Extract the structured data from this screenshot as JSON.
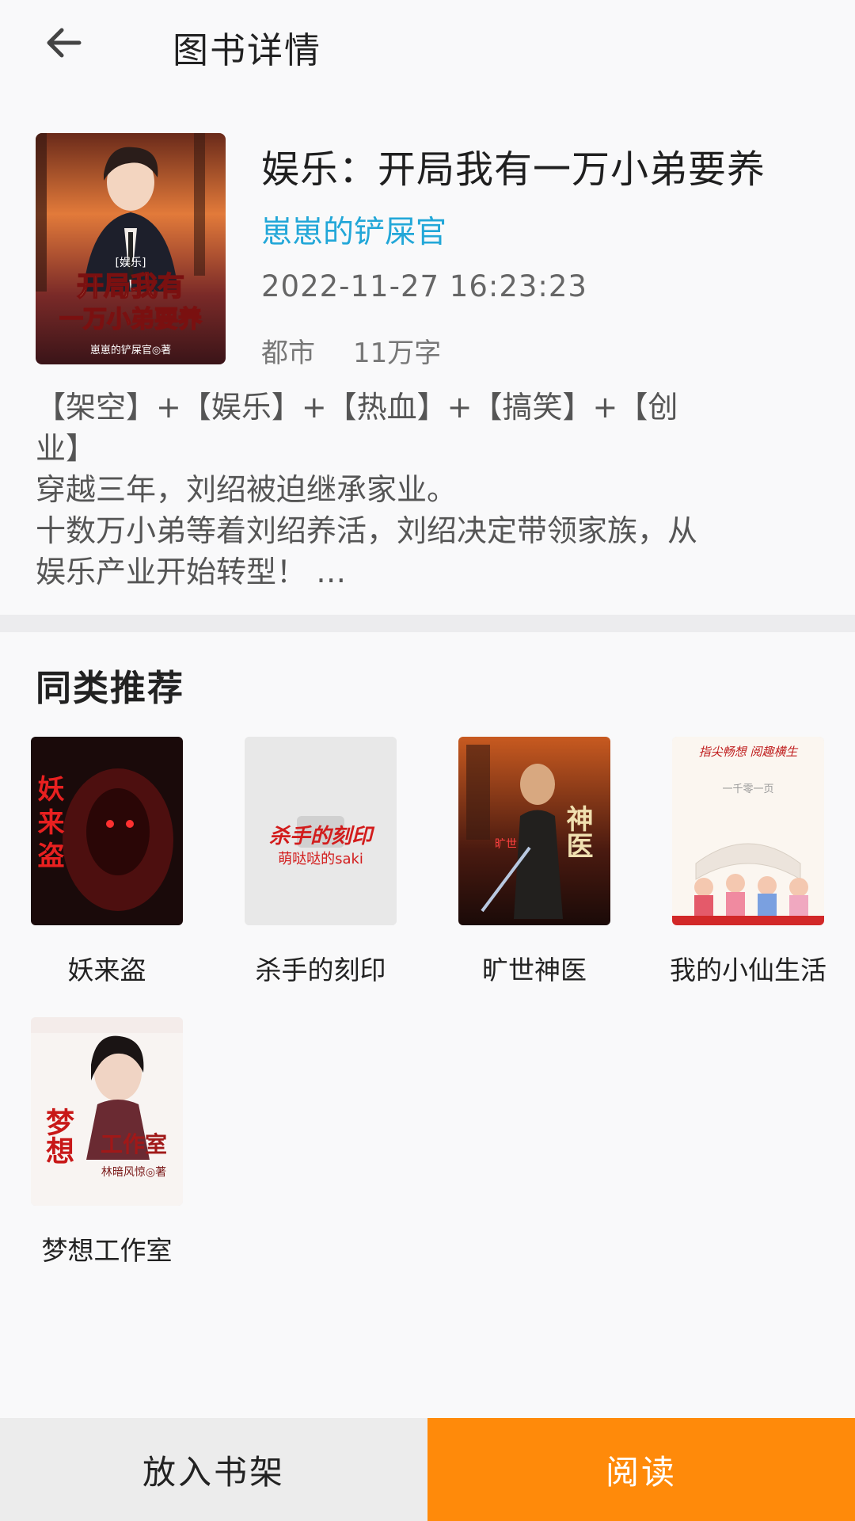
{
  "header": {
    "title": "图书详情"
  },
  "book": {
    "cover_text": {
      "tag": "[娱乐]",
      "line1": "开局我有",
      "line2": "一万小弟要养",
      "author_line": "崽崽的铲屎官◎著"
    },
    "title": "娱乐：开局我有一万小弟要养",
    "author": "崽崽的铲屎官",
    "updated": "2022-11-27 16:23:23",
    "category": "都市",
    "word_count": "11万字",
    "synopsis": [
      "【架空】+【娱乐】+【热血】+【搞笑】+【创",
      "业】",
      "穿越三年，刘绍被迫继承家业。",
      "十数万小弟等着刘绍养活，刘绍决定带领家族，从",
      "娱乐产业开始转型！ …"
    ]
  },
  "recommend": {
    "title": "同类推荐",
    "items": [
      {
        "title": "妖来盗",
        "cover_text": "妖来盗"
      },
      {
        "title": "杀手的刻印",
        "cover_text": "杀手的刻印",
        "cover_subtext": "萌哒哒的saki"
      },
      {
        "title": "旷世神医",
        "cover_text": "神医",
        "cover_subtext": "旷世"
      },
      {
        "title": "我的小仙生活",
        "cover_text": "指尖畅想 阅趣横生",
        "cover_subtext": "一千零一页"
      },
      {
        "title": "梦想工作室",
        "cover_text": "工作室",
        "cover_subtext": "梦想",
        "cover_author": "林暗风惊◎著"
      }
    ]
  },
  "bottom": {
    "shelf_label": "放入书架",
    "read_label": "阅读"
  },
  "colors": {
    "accent": "#ff8a0a",
    "author": "#22a7d8",
    "background": "#f9f9fa"
  }
}
